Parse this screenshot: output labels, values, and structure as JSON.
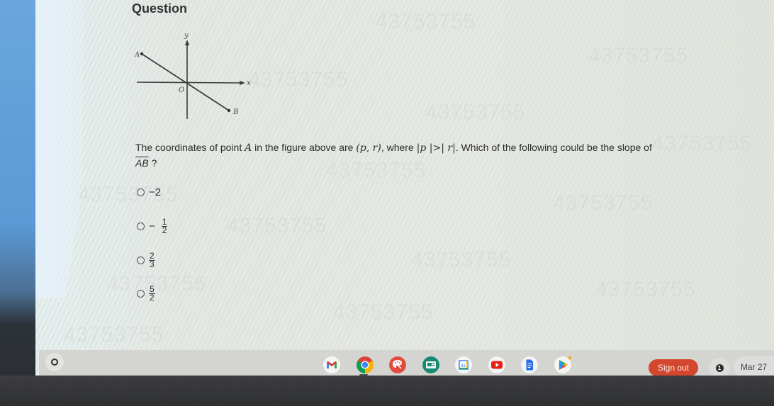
{
  "question": {
    "title": "Question",
    "figure": {
      "axis_x_label": "x",
      "axis_y_label": "y",
      "origin_label": "O",
      "point_a_label": "A",
      "point_b_label": "B"
    },
    "text_part1": "The coordinates of point",
    "point_a": "A",
    "text_part2": "in the figure above are",
    "coords": "(p, r)",
    "text_part3": ", where",
    "condition": "|p |>| r|",
    "text_part4": ". Which of the following could be the slope of",
    "segment": "AB",
    "text_part5": "?",
    "choices": [
      {
        "label": "−2",
        "sign": "−",
        "numerator": "2",
        "denominator": "",
        "selected": false
      },
      {
        "label": "−1/2",
        "sign": "−",
        "numerator": "1",
        "denominator": "2",
        "selected": false
      },
      {
        "label": "2/3",
        "sign": "",
        "numerator": "2",
        "denominator": "3",
        "selected": false
      },
      {
        "label": "5/2",
        "sign": "",
        "numerator": "5",
        "denominator": "2",
        "selected": false
      }
    ]
  },
  "watermark_text": "43753755",
  "shelf": {
    "launcher_icon": "launcher-circle-icon",
    "apps": [
      {
        "name": "Gmail",
        "icon": "gmail-icon"
      },
      {
        "name": "Chrome",
        "icon": "chrome-icon",
        "active": true
      },
      {
        "name": "Canvas",
        "icon": "palette-icon"
      },
      {
        "name": "Classroom",
        "icon": "classroom-icon"
      },
      {
        "name": "Calendar",
        "icon": "calendar-icon",
        "day": "31"
      },
      {
        "name": "YouTube",
        "icon": "youtube-icon"
      },
      {
        "name": "Docs",
        "icon": "docs-icon"
      },
      {
        "name": "Play Store",
        "icon": "play-store-icon"
      }
    ],
    "sign_out_label": "Sign out",
    "notification_count": "1",
    "date": "Mar 27"
  },
  "colors": {
    "sign_out_bg": "#d2472d",
    "shelf_bg": "#d4d4d1"
  }
}
